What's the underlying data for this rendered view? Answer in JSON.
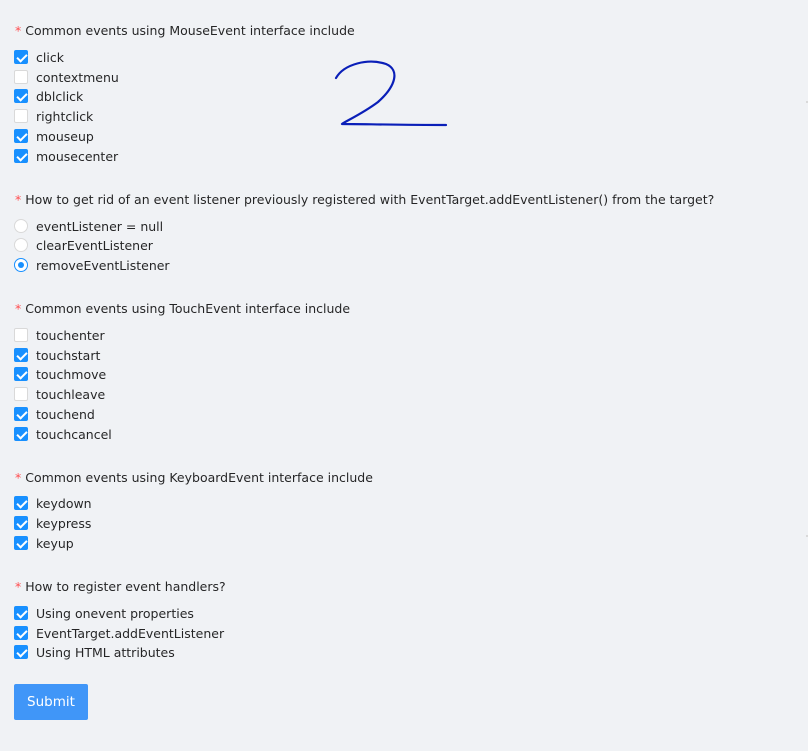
{
  "questions": [
    {
      "required_mark": "*",
      "label": "Common events using MouseEvent interface include",
      "type": "checkbox",
      "options": [
        {
          "label": "click",
          "checked": true
        },
        {
          "label": "contextmenu",
          "checked": false
        },
        {
          "label": "dblclick",
          "checked": true
        },
        {
          "label": "rightclick",
          "checked": false
        },
        {
          "label": "mouseup",
          "checked": true
        },
        {
          "label": "mousecenter",
          "checked": true
        }
      ]
    },
    {
      "required_mark": "*",
      "label": "How to get rid of an event listener previously registered with EventTarget.addEventListener() from the target?",
      "type": "radio",
      "options": [
        {
          "label": "eventListener = null",
          "checked": false
        },
        {
          "label": "clearEventListener",
          "checked": false
        },
        {
          "label": "removeEventListener",
          "checked": true
        }
      ]
    },
    {
      "required_mark": "*",
      "label": "Common events using TouchEvent interface include",
      "type": "checkbox",
      "options": [
        {
          "label": "touchenter",
          "checked": false
        },
        {
          "label": "touchstart",
          "checked": true
        },
        {
          "label": "touchmove",
          "checked": true
        },
        {
          "label": "touchleave",
          "checked": false
        },
        {
          "label": "touchend",
          "checked": true
        },
        {
          "label": "touchcancel",
          "checked": true
        }
      ]
    },
    {
      "required_mark": "*",
      "label": "Common events using KeyboardEvent interface include",
      "type": "checkbox",
      "options": [
        {
          "label": "keydown",
          "checked": true
        },
        {
          "label": "keypress",
          "checked": true
        },
        {
          "label": "keyup",
          "checked": true
        }
      ]
    },
    {
      "required_mark": "*",
      "label": "How to register event handlers?",
      "type": "checkbox",
      "options": [
        {
          "label": "Using onevent properties",
          "checked": true
        },
        {
          "label": "EventTarget.addEventListener",
          "checked": true
        },
        {
          "label": "Using HTML attributes",
          "checked": true
        }
      ]
    }
  ],
  "submit_label": "Submit",
  "colors": {
    "accent": "#1890ff",
    "required": "#ff4d4f",
    "background": "#f0f2f5",
    "button": "#4096f8",
    "scribble": "#0a1fb8"
  },
  "icons": {
    "checkbox_checked": "checkmark-icon",
    "radio_selected": "radio-dot-icon",
    "scribble": "handwritten-digit-2"
  }
}
